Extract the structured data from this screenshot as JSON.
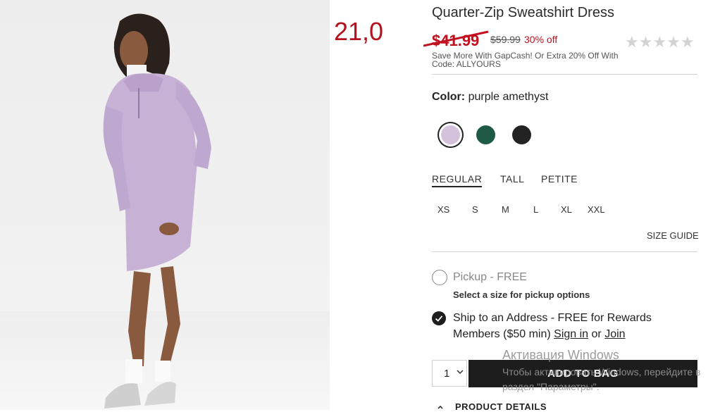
{
  "annotation": {
    "price_note": "21,0"
  },
  "product": {
    "title": "Quarter-Zip Sweatshirt Dress",
    "sale_price": "$41.99",
    "original_price": "$59.99",
    "discount": "30% off",
    "rating_stars": "★★★★★",
    "promo": "Save More With GapCash! Or Extra 20% Off With Code: ALLYOURS"
  },
  "color": {
    "label": "Color:",
    "selected_name": "purple amethyst",
    "swatches": [
      {
        "name": "purple amethyst",
        "hex": "#d4c1dc",
        "selected": true
      },
      {
        "name": "green",
        "hex": "#1f5a47",
        "selected": false
      },
      {
        "name": "black",
        "hex": "#232323",
        "selected": false
      }
    ]
  },
  "fit_tabs": [
    "REGULAR",
    "TALL",
    "PETITE"
  ],
  "sizes": [
    "XS",
    "S",
    "M",
    "L",
    "XL",
    "XXL"
  ],
  "size_guide": "SIZE GUIDE",
  "fulfillment": {
    "pickup_label": "Pickup - FREE",
    "pickup_note": "Select a size for pickup options",
    "ship_label_part1": "Ship to an Address - FREE for Rewards",
    "ship_label_part2": "Members ($50 min)",
    "sign_in": "Sign in",
    "or": "or",
    "join": "Join"
  },
  "cart": {
    "quantity": "1",
    "add_button": "ADD TO BAG"
  },
  "windows_overlay": {
    "title": "Активация Windows",
    "message": "Чтобы активировать Windows, перейдите в раздел \"Параметры\"."
  },
  "details_label": "PRODUCT DETAILS",
  "colors": {
    "sale_red": "#c2101e",
    "annotation_red": "#b3121e",
    "button_dark": "#1d1d1d",
    "dress_lilac": "#c7b2d6"
  }
}
